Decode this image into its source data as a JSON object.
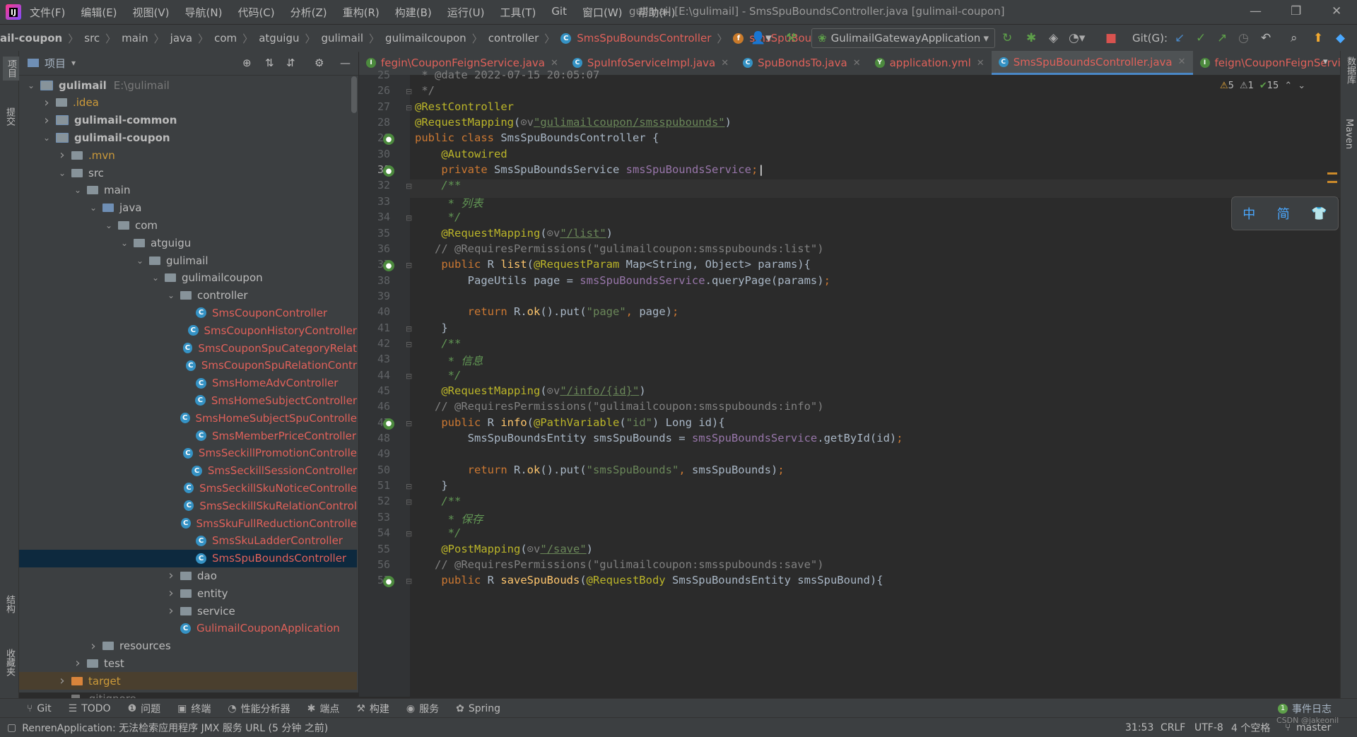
{
  "menu": [
    "文件(F)",
    "编辑(E)",
    "视图(V)",
    "导航(N)",
    "代码(C)",
    "分析(Z)",
    "重构(R)",
    "构建(B)",
    "运行(U)",
    "工具(T)",
    "Git",
    "窗口(W)",
    "帮助(H)"
  ],
  "window_title": "gulimail [E:\\gulimail] - SmsSpuBoundsController.java [gulimail-coupon]",
  "breadcrumb": [
    "ail-coupon",
    "src",
    "main",
    "java",
    "com",
    "atguigu",
    "gulimail",
    "gulimailcoupon",
    "controller",
    "SmsSpuBoundsController",
    "smsSpuBoundsService"
  ],
  "run_config": "GulimailGatewayApplication",
  "git_label": "Git(G):",
  "left_strip": [
    "项目",
    "提交",
    "结构",
    "收藏夹"
  ],
  "right_strip": [
    "数据库",
    "Maven"
  ],
  "project": {
    "title": "项目",
    "tree": [
      {
        "label": "gulimail",
        "extra": "E:\\gulimail",
        "depth": 0,
        "chev": "v",
        "icon": "mod",
        "style": "bold"
      },
      {
        "label": ".idea",
        "depth": 1,
        "chev": ">",
        "icon": "folder",
        "style": "yel"
      },
      {
        "label": "gulimail-common",
        "depth": 1,
        "chev": ">",
        "icon": "mod",
        "style": "bold"
      },
      {
        "label": "gulimail-coupon",
        "depth": 1,
        "chev": "v",
        "icon": "mod",
        "style": "bold"
      },
      {
        "label": ".mvn",
        "depth": 2,
        "chev": ">",
        "icon": "folder",
        "style": "yel"
      },
      {
        "label": "src",
        "depth": 2,
        "chev": "v",
        "icon": "folder",
        "style": ""
      },
      {
        "label": "main",
        "depth": 3,
        "chev": "v",
        "icon": "folder",
        "style": ""
      },
      {
        "label": "java",
        "depth": 4,
        "chev": "v",
        "icon": "blue",
        "style": ""
      },
      {
        "label": "com",
        "depth": 5,
        "chev": "v",
        "icon": "folder",
        "style": ""
      },
      {
        "label": "atguigu",
        "depth": 6,
        "chev": "v",
        "icon": "folder",
        "style": ""
      },
      {
        "label": "gulimail",
        "depth": 7,
        "chev": "v",
        "icon": "folder",
        "style": ""
      },
      {
        "label": "gulimailcoupon",
        "depth": 8,
        "chev": "v",
        "icon": "folder",
        "style": ""
      },
      {
        "label": "controller",
        "depth": 9,
        "chev": "v",
        "icon": "folder",
        "style": ""
      },
      {
        "label": "SmsCouponController",
        "depth": 10,
        "chev": "",
        "icon": "class",
        "style": "red"
      },
      {
        "label": "SmsCouponHistoryController",
        "depth": 10,
        "chev": "",
        "icon": "class",
        "style": "red"
      },
      {
        "label": "SmsCouponSpuCategoryRelat",
        "depth": 10,
        "chev": "",
        "icon": "class",
        "style": "red"
      },
      {
        "label": "SmsCouponSpuRelationContr",
        "depth": 10,
        "chev": "",
        "icon": "class",
        "style": "red"
      },
      {
        "label": "SmsHomeAdvController",
        "depth": 10,
        "chev": "",
        "icon": "class",
        "style": "red"
      },
      {
        "label": "SmsHomeSubjectController",
        "depth": 10,
        "chev": "",
        "icon": "class",
        "style": "red"
      },
      {
        "label": "SmsHomeSubjectSpuControlle",
        "depth": 10,
        "chev": "",
        "icon": "class",
        "style": "red"
      },
      {
        "label": "SmsMemberPriceController",
        "depth": 10,
        "chev": "",
        "icon": "class",
        "style": "red"
      },
      {
        "label": "SmsSeckillPromotionControlle",
        "depth": 10,
        "chev": "",
        "icon": "class",
        "style": "red"
      },
      {
        "label": "SmsSeckillSessionController",
        "depth": 10,
        "chev": "",
        "icon": "class",
        "style": "red"
      },
      {
        "label": "SmsSeckillSkuNoticeControlle",
        "depth": 10,
        "chev": "",
        "icon": "class",
        "style": "red"
      },
      {
        "label": "SmsSeckillSkuRelationControl",
        "depth": 10,
        "chev": "",
        "icon": "class",
        "style": "red"
      },
      {
        "label": "SmsSkuFullReductionControlle",
        "depth": 10,
        "chev": "",
        "icon": "class",
        "style": "red"
      },
      {
        "label": "SmsSkuLadderController",
        "depth": 10,
        "chev": "",
        "icon": "class",
        "style": "red"
      },
      {
        "label": "SmsSpuBoundsController",
        "depth": 10,
        "chev": "",
        "icon": "class",
        "style": "red",
        "selected": true
      },
      {
        "label": "dao",
        "depth": 9,
        "chev": ">",
        "icon": "folder",
        "style": ""
      },
      {
        "label": "entity",
        "depth": 9,
        "chev": ">",
        "icon": "folder",
        "style": ""
      },
      {
        "label": "service",
        "depth": 9,
        "chev": ">",
        "icon": "folder",
        "style": ""
      },
      {
        "label": "GulimailCouponApplication",
        "depth": 9,
        "chev": "",
        "icon": "class",
        "style": "red"
      },
      {
        "label": "resources",
        "depth": 4,
        "chev": ">",
        "icon": "folder",
        "style": ""
      },
      {
        "label": "test",
        "depth": 3,
        "chev": ">",
        "icon": "folder",
        "style": ""
      },
      {
        "label": "target",
        "depth": 2,
        "chev": ">",
        "icon": "orange",
        "style": "yel",
        "target": true
      },
      {
        "label": ".gitignore",
        "depth": 2,
        "chev": "",
        "icon": "file",
        "style": "dim"
      }
    ]
  },
  "tabs": [
    {
      "label": "fegin\\CouponFeignService.java",
      "icon": "I",
      "color": "#4c8a3e",
      "active": false
    },
    {
      "label": "SpuInfoServiceImpl.java",
      "icon": "C",
      "color": "#3592c4",
      "active": false
    },
    {
      "label": "SpuBondsTo.java",
      "icon": "C",
      "color": "#3592c4",
      "active": false
    },
    {
      "label": "application.yml",
      "icon": "Y",
      "color": "#4c8a3e",
      "active": false
    },
    {
      "label": "SmsSpuBoundsController.java",
      "icon": "C",
      "color": "#3592c4",
      "active": true
    },
    {
      "label": "feign\\CouponFeignService.java",
      "icon": "I",
      "color": "#4c8a3e",
      "active": false
    }
  ],
  "inspections": {
    "warnings": "5",
    "weak": "1",
    "ok": "15"
  },
  "line_numbers": [
    "25",
    "26",
    "27",
    "28",
    "29",
    "30",
    "31",
    "32",
    "33",
    "34",
    "35",
    "36",
    "37",
    "38",
    "39",
    "40",
    "41",
    "42",
    "43",
    "44",
    "45",
    "46",
    "47",
    "48",
    "49",
    "50",
    "51",
    "52",
    "53",
    "54",
    "55",
    "56",
    "57"
  ],
  "gutter_icons": [
    29,
    31,
    37,
    47,
    57
  ],
  "code_lines": [
    [
      [
        "cmt",
        " * "
      ],
      [
        "cmt",
        "@date"
      ],
      [
        "cmt",
        " 2022-07-15 20:05:07"
      ]
    ],
    [
      [
        "cmt",
        " */"
      ]
    ],
    [
      [
        "ann",
        "@RestController"
      ]
    ],
    [
      [
        "ann",
        "@RequestMapping"
      ],
      [
        "",
        "("
      ],
      [
        "cmt",
        "⊙v"
      ],
      [
        "ustr",
        "\"gulimailcoupon/smsspubounds\""
      ],
      [
        "",
        ")"
      ]
    ],
    [
      [
        "kw",
        "public class "
      ],
      [
        "",
        "SmsSpuBoundsController {"
      ]
    ],
    [
      [
        "",
        "    "
      ],
      [
        "ann",
        "@Autowired"
      ]
    ],
    [
      [
        "",
        "    "
      ],
      [
        "kw",
        "private "
      ],
      [
        "",
        "SmsSpuBoundsService "
      ],
      [
        "fld",
        "smsSpuBoundsService"
      ],
      [
        "kw",
        ";"
      ]
    ],
    [
      [
        "",
        "    "
      ],
      [
        "doc",
        "/**"
      ]
    ],
    [
      [
        "",
        "    "
      ],
      [
        "doc",
        " * 列表"
      ]
    ],
    [
      [
        "",
        "    "
      ],
      [
        "doc",
        " */"
      ]
    ],
    [
      [
        "",
        "    "
      ],
      [
        "ann",
        "@RequestMapping"
      ],
      [
        "",
        "("
      ],
      [
        "cmt",
        "⊙v"
      ],
      [
        "ustr",
        "\"/list\""
      ],
      [
        "",
        ")"
      ]
    ],
    [
      [
        "",
        "   "
      ],
      [
        "cmt",
        "// @RequiresPermissions(\"gulimailcoupon:smsspubounds:list\")"
      ]
    ],
    [
      [
        "",
        "    "
      ],
      [
        "kw",
        "public "
      ],
      [
        "",
        "R "
      ],
      [
        "mth",
        "list"
      ],
      [
        "",
        "("
      ],
      [
        "ann",
        "@RequestParam "
      ],
      [
        "",
        "Map<String, Object> params){"
      ]
    ],
    [
      [
        "",
        "        PageUtils page = "
      ],
      [
        "fld",
        "smsSpuBoundsService"
      ],
      [
        "",
        ".queryPage(params)"
      ],
      [
        "kw",
        ";"
      ]
    ],
    [
      [
        "",
        ""
      ]
    ],
    [
      [
        "",
        "        "
      ],
      [
        "kw",
        "return "
      ],
      [
        "",
        "R."
      ],
      [
        "mth",
        "ok"
      ],
      [
        "",
        "().put("
      ],
      [
        "str",
        "\"page\""
      ],
      [
        "kw",
        ", "
      ],
      [
        "",
        "page)"
      ],
      [
        "kw",
        ";"
      ]
    ],
    [
      [
        "",
        "    }"
      ]
    ],
    [
      [
        "",
        "    "
      ],
      [
        "doc",
        "/**"
      ]
    ],
    [
      [
        "",
        "    "
      ],
      [
        "doc",
        " * 信息"
      ]
    ],
    [
      [
        "",
        "    "
      ],
      [
        "doc",
        " */"
      ]
    ],
    [
      [
        "",
        "    "
      ],
      [
        "ann",
        "@RequestMapping"
      ],
      [
        "",
        "("
      ],
      [
        "cmt",
        "⊙v"
      ],
      [
        "ustr",
        "\"/info/{id}\""
      ],
      [
        "",
        ")"
      ]
    ],
    [
      [
        "",
        "   "
      ],
      [
        "cmt",
        "// @RequiresPermissions(\"gulimailcoupon:smsspubounds:info\")"
      ]
    ],
    [
      [
        "",
        "    "
      ],
      [
        "kw",
        "public "
      ],
      [
        "",
        "R "
      ],
      [
        "mth",
        "info"
      ],
      [
        "",
        "("
      ],
      [
        "ann",
        "@PathVariable"
      ],
      [
        "",
        "("
      ],
      [
        "str",
        "\"id\""
      ],
      [
        "",
        ") Long id){"
      ]
    ],
    [
      [
        "",
        "        SmsSpuBoundsEntity smsSpuBounds = "
      ],
      [
        "fld",
        "smsSpuBoundsService"
      ],
      [
        "",
        ".getById(id)"
      ],
      [
        "kw",
        ";"
      ]
    ],
    [
      [
        "",
        ""
      ]
    ],
    [
      [
        "",
        "        "
      ],
      [
        "kw",
        "return "
      ],
      [
        "",
        "R."
      ],
      [
        "mth",
        "ok"
      ],
      [
        "",
        "().put("
      ],
      [
        "str",
        "\"smsSpuBounds\""
      ],
      [
        "kw",
        ", "
      ],
      [
        "",
        "smsSpuBounds)"
      ],
      [
        "kw",
        ";"
      ]
    ],
    [
      [
        "",
        "    }"
      ]
    ],
    [
      [
        "",
        "    "
      ],
      [
        "doc",
        "/**"
      ]
    ],
    [
      [
        "",
        "    "
      ],
      [
        "doc",
        " * 保存"
      ]
    ],
    [
      [
        "",
        "    "
      ],
      [
        "doc",
        " */"
      ]
    ],
    [
      [
        "",
        "    "
      ],
      [
        "ann",
        "@PostMapping"
      ],
      [
        "",
        "("
      ],
      [
        "cmt",
        "⊙v"
      ],
      [
        "ustr",
        "\"/save\""
      ],
      [
        "",
        ")"
      ]
    ],
    [
      [
        "",
        "   "
      ],
      [
        "cmt",
        "// @RequiresPermissions(\"gulimailcoupon:smsspubounds:save\")"
      ]
    ],
    [
      [
        "",
        "    "
      ],
      [
        "kw",
        "public "
      ],
      [
        "",
        "R "
      ],
      [
        "mth",
        "saveSpuBouds"
      ],
      [
        "",
        "("
      ],
      [
        "ann",
        "@RequestBody "
      ],
      [
        "",
        "SmsSpuBoundsEntity smsSpuBound){"
      ]
    ]
  ],
  "ime": [
    "中",
    "简",
    "👕"
  ],
  "bottom_tools": [
    {
      "icon": "⑂",
      "label": "Git"
    },
    {
      "icon": "☰",
      "label": "TODO"
    },
    {
      "icon": "❶",
      "label": "问题"
    },
    {
      "icon": "▣",
      "label": "终端"
    },
    {
      "icon": "◔",
      "label": "性能分析器"
    },
    {
      "icon": "✱",
      "label": "端点"
    },
    {
      "icon": "⚒",
      "label": "构建"
    },
    {
      "icon": "◉",
      "label": "服务"
    },
    {
      "icon": "✿",
      "label": "Spring"
    }
  ],
  "event_log": "事件日志",
  "event_count": "1",
  "status": {
    "message": "RenrenApplication: 无法检索应用程序 JMX 服务 URL (5 分钟 之前)",
    "position": "31:53",
    "line_sep": "CRLF",
    "encoding": "UTF-8",
    "indent": "4 个空格",
    "branch": "master",
    "watermark": "CSDN @jakeonil"
  },
  "colors": {
    "accent": "#4a88c7",
    "error": "#e0615a",
    "bg": "#2b2b2b",
    "panel": "#3c3f41"
  }
}
